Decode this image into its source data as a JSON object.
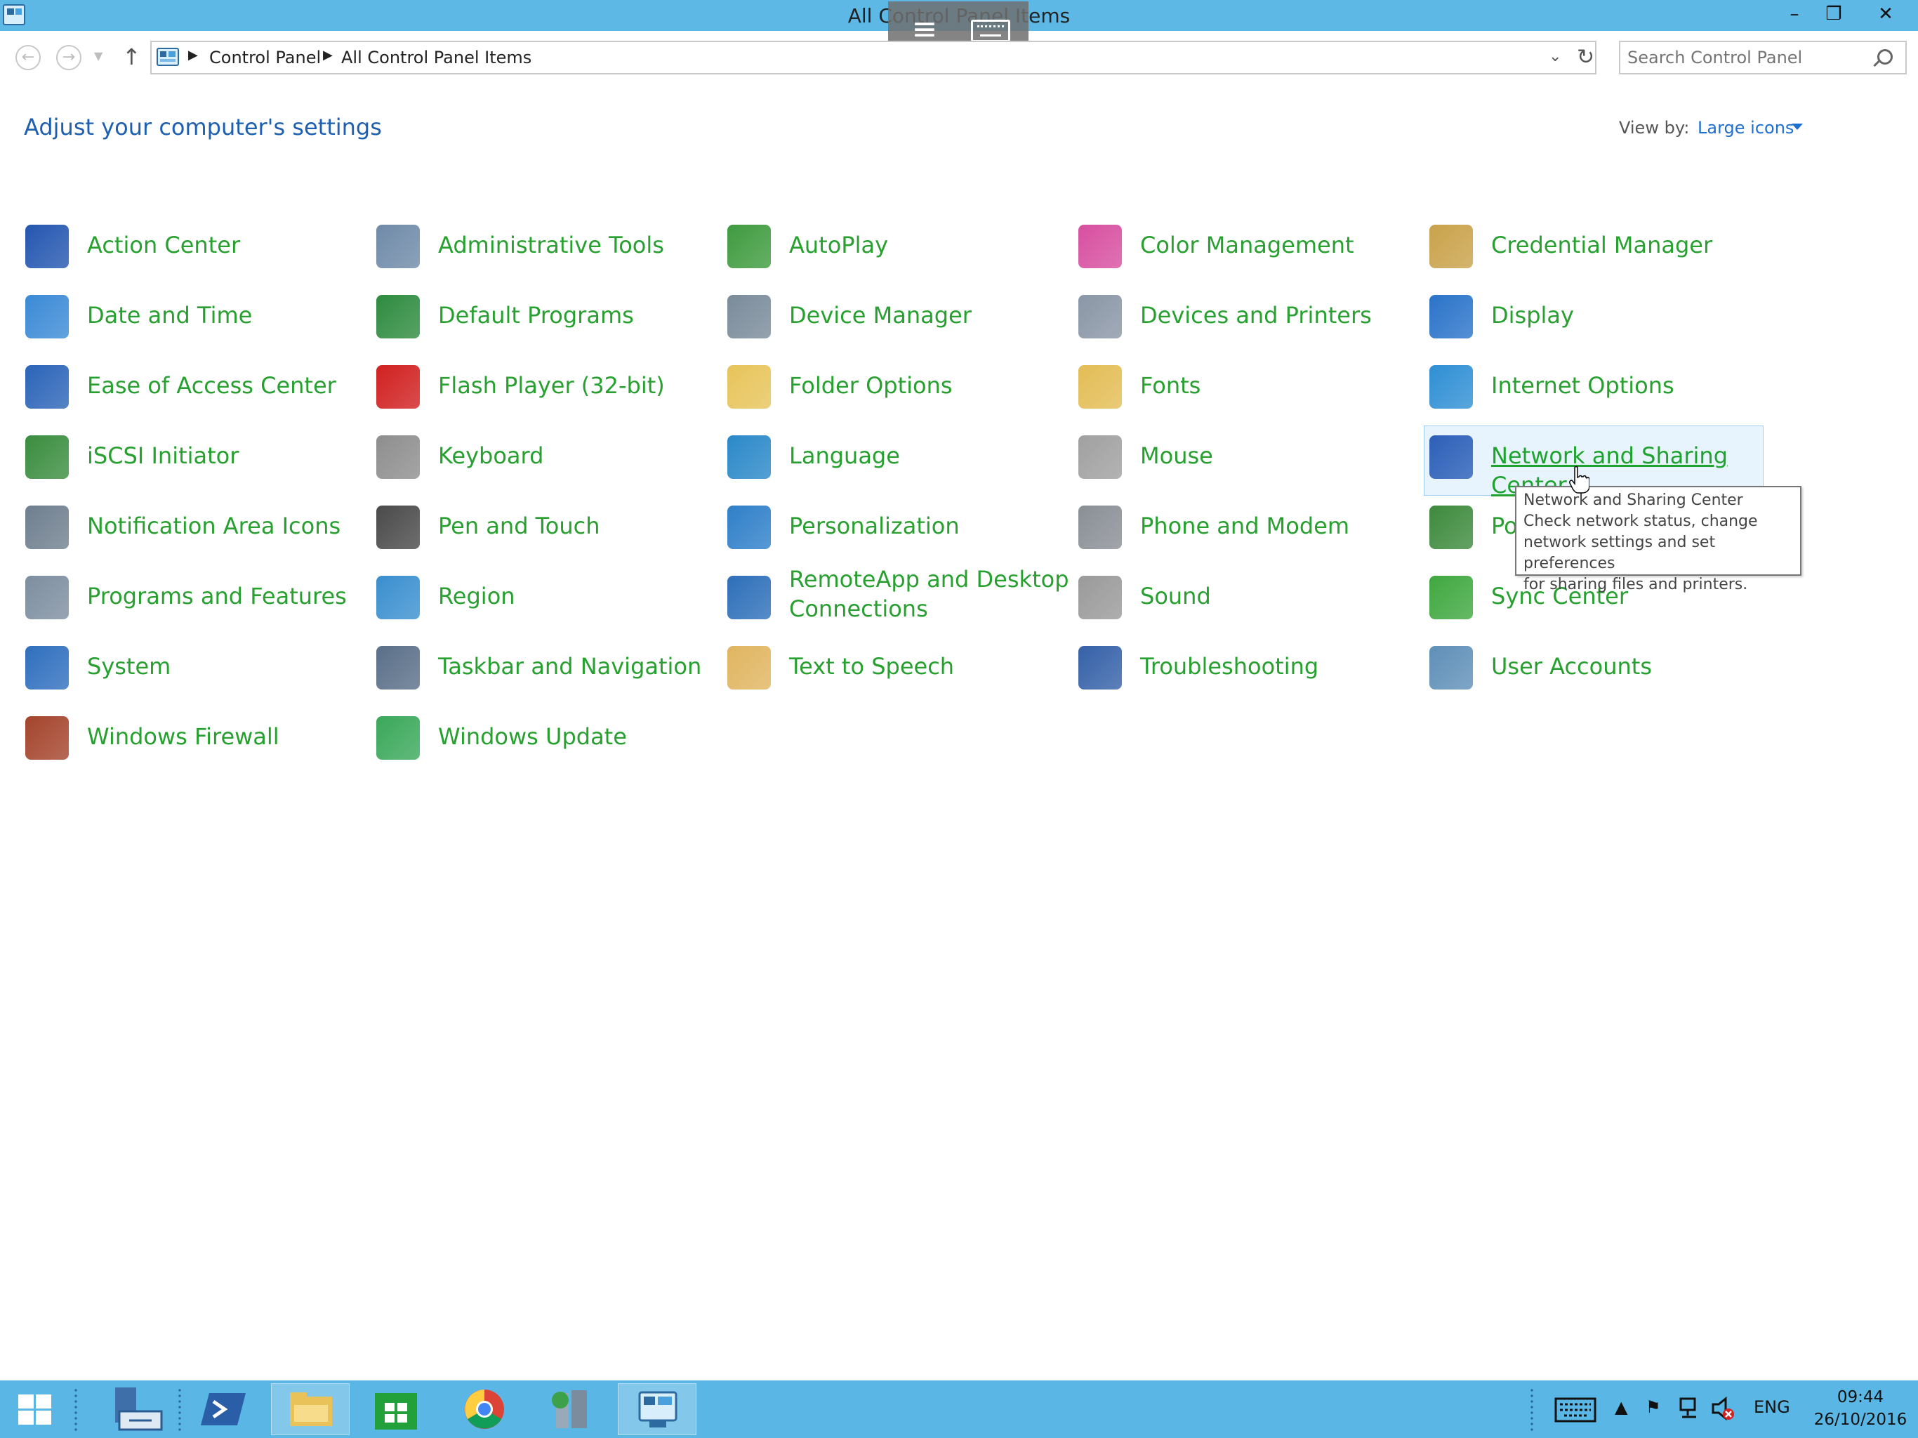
{
  "window": {
    "title": "All Control Panel Items",
    "minimize": "–",
    "restore": "❐",
    "close": "✕"
  },
  "address": {
    "crumbs": [
      "Control Panel",
      "All Control Panel Items"
    ],
    "search_placeholder": "Search Control Panel"
  },
  "header": {
    "title": "Adjust your computer's settings",
    "view_by_label": "View by:",
    "view_by_value": "Large icons"
  },
  "items": [
    {
      "label": "Action Center",
      "icon": "flag-icon",
      "color": "#2456b0"
    },
    {
      "label": "Administrative Tools",
      "icon": "admin-tools-icon",
      "color": "#6f8aa8"
    },
    {
      "label": "AutoPlay",
      "icon": "autoplay-icon",
      "color": "#3f9b3f"
    },
    {
      "label": "Color Management",
      "icon": "color-management-icon",
      "color": "#d74fa0"
    },
    {
      "label": "Credential Manager",
      "icon": "vault-icon",
      "color": "#c9a24a"
    },
    {
      "label": "Date and Time",
      "icon": "calendar-clock-icon",
      "color": "#3b8ad6"
    },
    {
      "label": "Default Programs",
      "icon": "default-programs-icon",
      "color": "#2e8b3f"
    },
    {
      "label": "Device Manager",
      "icon": "device-manager-icon",
      "color": "#7a8b9a"
    },
    {
      "label": "Devices and Printers",
      "icon": "printer-icon",
      "color": "#8a96a6"
    },
    {
      "label": "Display",
      "icon": "monitor-icon",
      "color": "#2a73c9"
    },
    {
      "label": "Ease of Access Center",
      "icon": "ease-of-access-icon",
      "color": "#2b64b8"
    },
    {
      "label": "Flash Player (32-bit)",
      "icon": "flash-icon",
      "color": "#d12020"
    },
    {
      "label": "Folder Options",
      "icon": "folder-icon",
      "color": "#e7c45a"
    },
    {
      "label": "Fonts",
      "icon": "fonts-folder-icon",
      "color": "#e3bd55"
    },
    {
      "label": "Internet Options",
      "icon": "globe-icon",
      "color": "#2f8fd4"
    },
    {
      "label": "iSCSI Initiator",
      "icon": "iscsi-globe-icon",
      "color": "#3a8d3f"
    },
    {
      "label": "Keyboard",
      "icon": "keyboard-icon",
      "color": "#8e8e8e"
    },
    {
      "label": "Language",
      "icon": "language-icon",
      "color": "#2a88c8"
    },
    {
      "label": "Mouse",
      "icon": "mouse-icon",
      "color": "#a0a0a0"
    },
    {
      "label": "Network and Sharing Center",
      "icon": "network-icon",
      "color": "#2c5fb8"
    },
    {
      "label": "Notification Area Icons",
      "icon": "notification-icons-icon",
      "color": "#6f7f8f"
    },
    {
      "label": "Pen and Touch",
      "icon": "pen-icon",
      "color": "#4a4a4a"
    },
    {
      "label": "Personalization",
      "icon": "personalization-icon",
      "color": "#2f7fc9"
    },
    {
      "label": "Phone and Modem",
      "icon": "phone-icon",
      "color": "#8a8f96"
    },
    {
      "label": "Power Options",
      "icon": "battery-icon",
      "color": "#3d8a3d"
    },
    {
      "label": "Programs and Features",
      "icon": "programs-icon",
      "color": "#7d8ea0"
    },
    {
      "label": "Region",
      "icon": "region-clock-icon",
      "color": "#3a8fcf"
    },
    {
      "label": "RemoteApp and Desktop Connections",
      "icon": "remoteapp-icon",
      "color": "#2d6fb9"
    },
    {
      "label": "Sound",
      "icon": "speaker-icon",
      "color": "#9a9a9a"
    },
    {
      "label": "Sync Center",
      "icon": "sync-icon",
      "color": "#3fa83f"
    },
    {
      "label": "System",
      "icon": "system-icon",
      "color": "#2f6fbe"
    },
    {
      "label": "Taskbar and Navigation",
      "icon": "taskbar-icon",
      "color": "#5a6f88"
    },
    {
      "label": "Text to Speech",
      "icon": "speech-bubble-icon",
      "color": "#e0b560"
    },
    {
      "label": "Troubleshooting",
      "icon": "troubleshooting-icon",
      "color": "#3561a8"
    },
    {
      "label": "User Accounts",
      "icon": "users-icon",
      "color": "#5f8fb8"
    },
    {
      "label": "Windows Firewall",
      "icon": "firewall-icon",
      "color": "#a4442c"
    },
    {
      "label": "Windows Update",
      "icon": "windows-update-icon",
      "color": "#3aa85a"
    }
  ],
  "tooltip": {
    "lines": [
      "Network and Sharing Center",
      "Check network status, change",
      "network settings and set preferences",
      "for sharing files and printers."
    ]
  },
  "taskbar": {
    "language": "ENG",
    "time": "09:44",
    "date": "26/10/2016"
  }
}
